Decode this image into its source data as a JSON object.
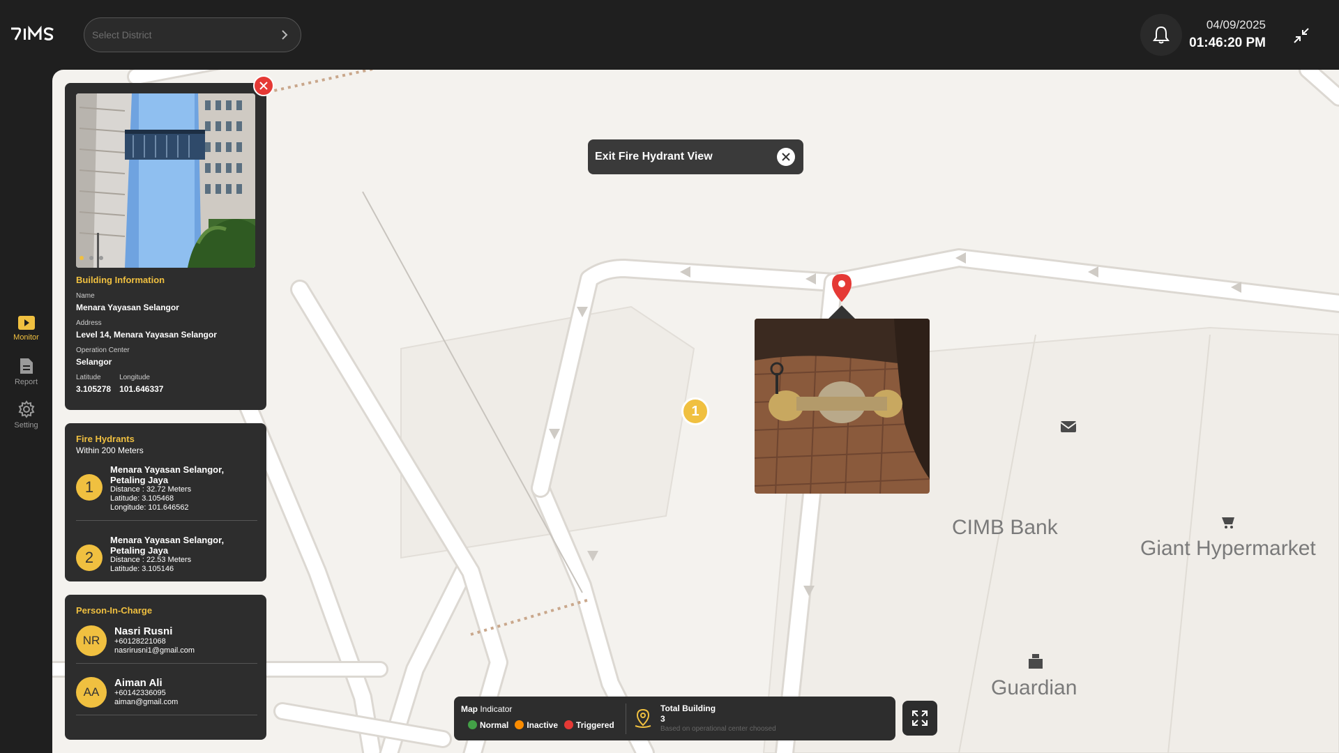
{
  "app": {
    "logo": "RIMS"
  },
  "header": {
    "district_placeholder": "Select District",
    "date": "04/09/2025",
    "time": "01:46:20 PM"
  },
  "nav": {
    "items": [
      {
        "label": "Monitor",
        "icon": "monitor-icon",
        "active": true
      },
      {
        "label": "Report",
        "icon": "report-icon",
        "active": false
      },
      {
        "label": "Setting",
        "icon": "gear-icon",
        "active": false
      }
    ]
  },
  "building": {
    "title": "Building Information",
    "name_label": "Name",
    "name": "Menara Yayasan Selangor",
    "address_label": "Address",
    "address": "Level 14, Menara Yayasan Selangor",
    "op_label": "Operation Center",
    "op_center": "Selangor",
    "lat_label": "Latitude",
    "lat": "3.105278",
    "long_label": "Longitude",
    "long": "101.646337"
  },
  "hydrants": {
    "title": "Fire Hydrants",
    "subtitle": "Within 200 Meters",
    "items": [
      {
        "num": "1",
        "name_line1": "Menara Yayasan Selangor,",
        "name_line2": "Petaling Jaya",
        "distance": "Distance : 32.72 Meters",
        "latitude": "Latitude: 3.105468",
        "longitude": "Longitude: 101.646562"
      },
      {
        "num": "2",
        "name_line1": "Menara Yayasan Selangor,",
        "name_line2": "Petaling Jaya",
        "distance": "Distance : 22.53 Meters",
        "latitude": "Latitude: 3.105146"
      }
    ]
  },
  "pic": {
    "title": "Person-In-Charge",
    "people": [
      {
        "initials": "NR",
        "name": "Nasri Rusni",
        "phone": "+60128221068",
        "email": "nasrirusni1@gmail.com"
      },
      {
        "initials": "AA",
        "name": "Aiman Ali",
        "phone": "+60142336095",
        "email": "aiman@gmail.com"
      }
    ]
  },
  "map": {
    "exit_label": "Exit Fire Hydrant View",
    "marker_num": "1",
    "pois": [
      "CIMB Bank",
      "Giant Hypermarket",
      "Guardian"
    ]
  },
  "legend": {
    "title_bold": "Map",
    "title_rest": "Indicator",
    "items": [
      {
        "label": "Normal",
        "color": "#43a047"
      },
      {
        "label": "Inactive",
        "color": "#fb8c00"
      },
      {
        "label": "Triggered",
        "color": "#e53935"
      }
    ],
    "total_title": "Total Building",
    "total_value": "3",
    "total_note": "Based on operational center choosed"
  },
  "colors": {
    "accent": "#f0c040",
    "panel": "#2d2d2d",
    "danger": "#e53935"
  }
}
